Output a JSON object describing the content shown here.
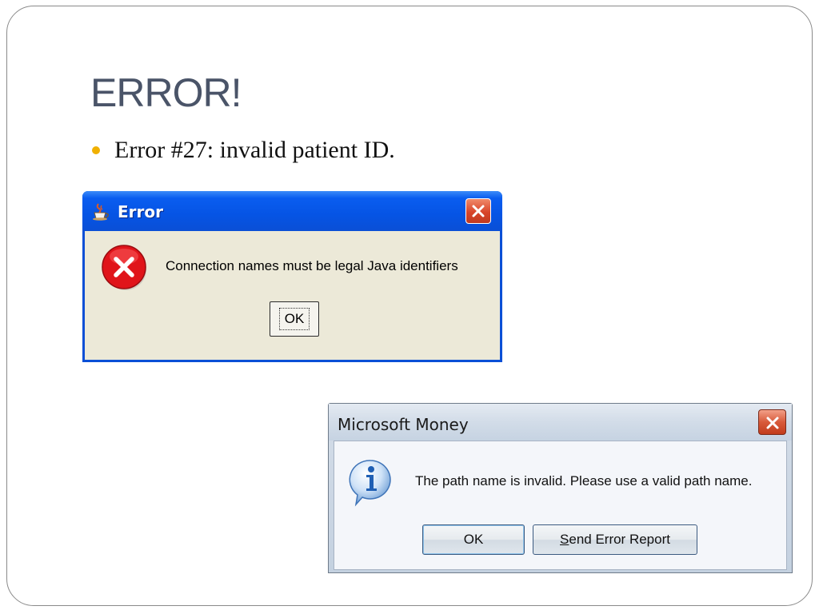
{
  "slide": {
    "title": "ERROR!",
    "bullet": "Error #27: invalid patient ID."
  },
  "java_dialog": {
    "title": "Error",
    "message": "Connection names must be legal Java identifiers",
    "ok_label": "OK",
    "icons": [
      "java-app-icon",
      "error-icon",
      "close-icon"
    ]
  },
  "money_dialog": {
    "title": "Microsoft Money",
    "message": "The path name is invalid. Please use a valid path name.",
    "ok_label": "OK",
    "report_mnemonic": "S",
    "report_label_rest": "end Error Report",
    "icons": [
      "info-icon",
      "close-icon"
    ]
  },
  "colors": {
    "title_text": "#4a5468",
    "bullet": "#f0b000",
    "xp_titlebar": "#0654e4",
    "xp_dialog_body": "#ece9d8",
    "close_button": "#d8452a",
    "error_icon": "#e0141a",
    "info_icon": "#1f5fb4"
  }
}
